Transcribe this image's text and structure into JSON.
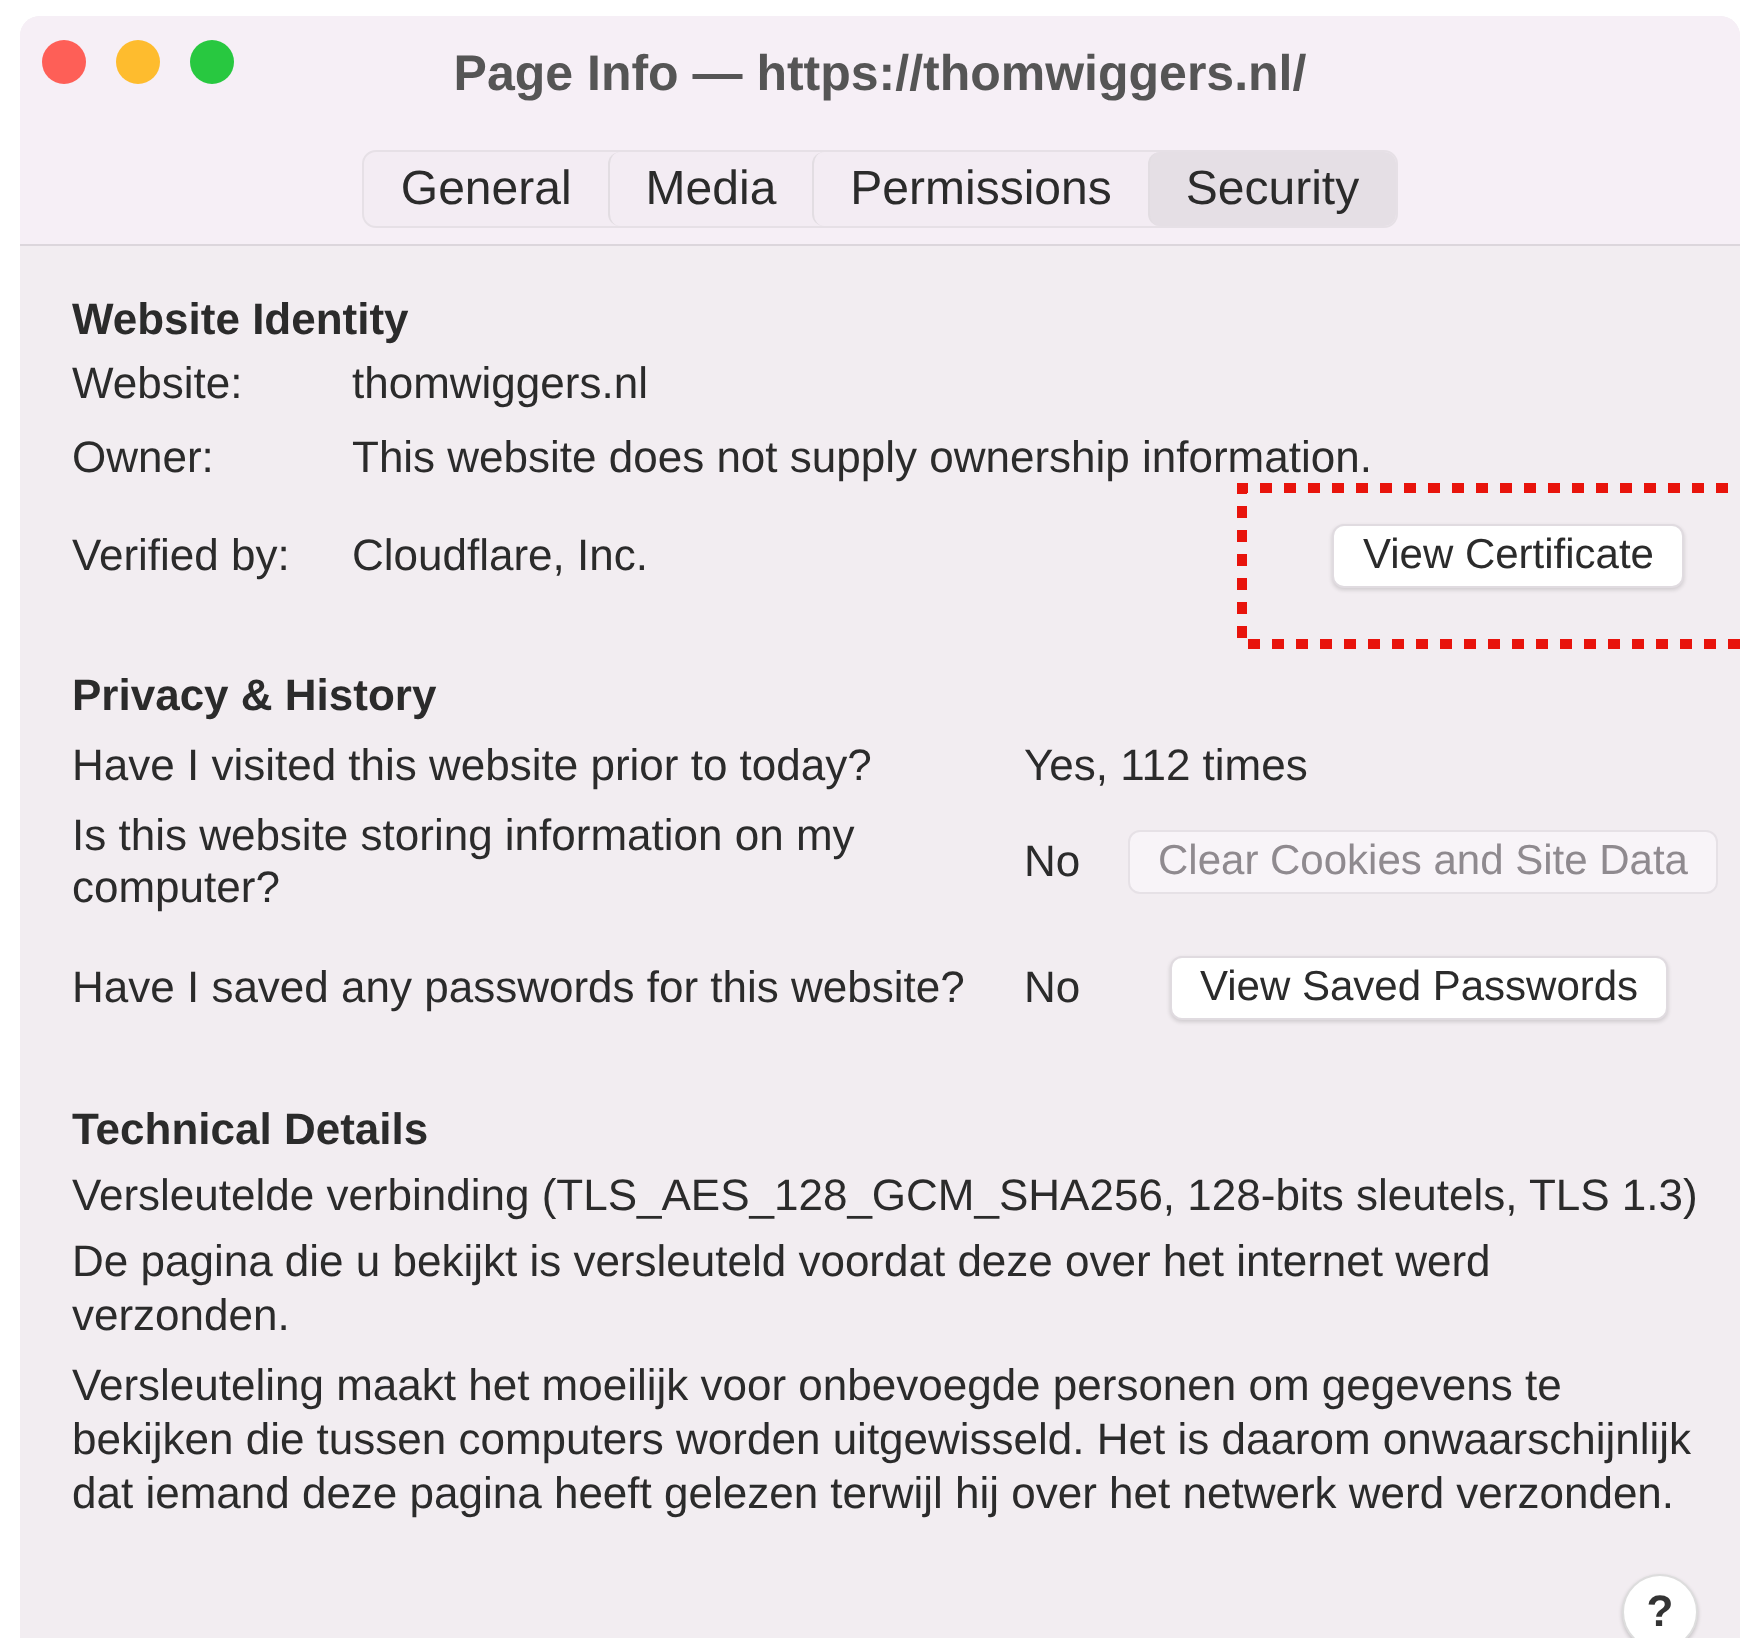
{
  "window": {
    "title": "Page Info — https://thomwiggers.nl/"
  },
  "tabs": [
    {
      "label": "General",
      "selected": false
    },
    {
      "label": "Media",
      "selected": false
    },
    {
      "label": "Permissions",
      "selected": false
    },
    {
      "label": "Security",
      "selected": true
    }
  ],
  "identity": {
    "heading": "Website Identity",
    "rows": [
      {
        "label": "Website:",
        "value": "thomwiggers.nl"
      },
      {
        "label": "Owner:",
        "value": "This website does not supply ownership information."
      },
      {
        "label": "Verified by:",
        "value": "Cloudflare, Inc.",
        "button": {
          "label": "View Certificate",
          "disabled": false
        }
      }
    ]
  },
  "privacy": {
    "heading": "Privacy & History",
    "rows": [
      {
        "question": "Have I visited this website prior to today?",
        "answer": "Yes, 112 times"
      },
      {
        "question": "Is this website storing information on my computer?",
        "answer": "No",
        "button": {
          "label": "Clear Cookies and Site Data",
          "disabled": true
        }
      },
      {
        "question": "Have I saved any passwords for this website?",
        "answer": "No",
        "button": {
          "label": "View Saved Passwords",
          "disabled": false
        }
      }
    ]
  },
  "technical": {
    "heading": "Technical Details",
    "paragraphs": [
      "Versleutelde verbinding (TLS_AES_128_GCM_SHA256, 128-bits sleutels, TLS 1.3)",
      "De pagina die u bekijkt is versleuteld voordat deze over het internet werd verzonden.",
      "Versleuteling maakt het moeilijk voor onbevoegde personen om gegevens te bekijken die tussen computers worden uitgewisseld. Het is daarom onwaarschijnlijk dat iemand deze pagina heeft gelezen terwijl hij over het netwerk werd verzonden."
    ]
  },
  "help_button": {
    "label": "?"
  }
}
